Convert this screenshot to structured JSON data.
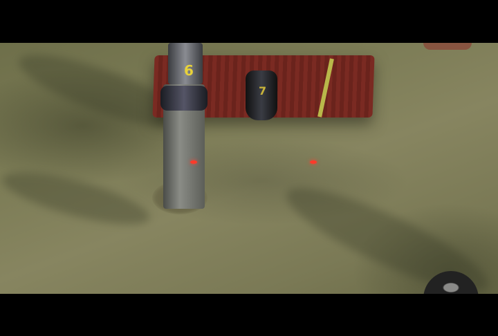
{
  "scene": {
    "description_labels": {
      "tube_left_number": "6",
      "tube_right_number": "7"
    },
    "colors": {
      "seafloor": "#7b7b55",
      "crate": "#7a2a22",
      "laser": "#ff3a2a",
      "label": "#e8d23a"
    }
  }
}
